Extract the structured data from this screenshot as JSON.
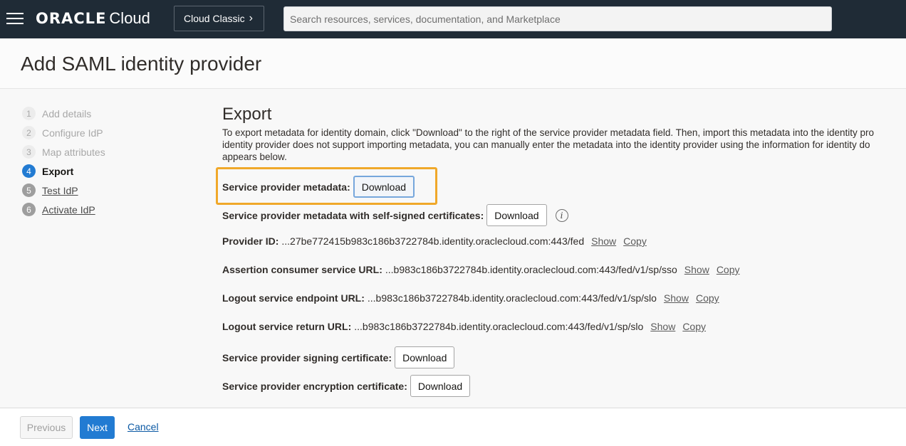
{
  "header": {
    "brand": "ORACLE",
    "product": "Cloud",
    "classic_button": "Cloud Classic",
    "search_placeholder": "Search resources, services, documentation, and Marketplace"
  },
  "page": {
    "title": "Add SAML identity provider"
  },
  "steps": [
    {
      "num": "1",
      "label": "Add details",
      "state": "done"
    },
    {
      "num": "2",
      "label": "Configure IdP",
      "state": "done"
    },
    {
      "num": "3",
      "label": "Map attributes",
      "state": "done"
    },
    {
      "num": "4",
      "label": "Export",
      "state": "active"
    },
    {
      "num": "5",
      "label": "Test IdP",
      "state": "link"
    },
    {
      "num": "6",
      "label": "Activate IdP",
      "state": "link"
    }
  ],
  "export": {
    "title": "Export",
    "description_lines": [
      "To export metadata for identity domain, click \"Download\" to the right of the service provider metadata field. Then, import this metadata into the identity pro",
      "identity provider does not support importing metadata, you can manually enter the metadata into the identity provider using the information for identity do",
      "appears below."
    ],
    "sp_metadata_label": "Service provider metadata:",
    "sp_metadata_self_signed_label": "Service provider metadata with self-signed certificates:",
    "download_label": "Download",
    "info_icon": "i",
    "provider_id": {
      "label": "Provider ID:",
      "value": "...27be772415b983c186b3722784b.identity.oraclecloud.com:443/fed"
    },
    "acs_url": {
      "label": "Assertion consumer service URL:",
      "value": "...b983c186b3722784b.identity.oraclecloud.com:443/fed/v1/sp/sso"
    },
    "logout_endpoint": {
      "label": "Logout service endpoint URL:",
      "value": "...b983c186b3722784b.identity.oraclecloud.com:443/fed/v1/sp/slo"
    },
    "logout_return": {
      "label": "Logout service return URL:",
      "value": "...b983c186b3722784b.identity.oraclecloud.com:443/fed/v1/sp/slo"
    },
    "show_label": "Show",
    "copy_label": "Copy",
    "signing_cert_label": "Service provider signing certificate:",
    "encryption_cert_label": "Service provider encryption certificate:"
  },
  "footer": {
    "previous_label": "Previous",
    "next_label": "Next",
    "cancel_label": "Cancel"
  },
  "colors": {
    "topbar": "#1f2b36",
    "accent": "#227bd2",
    "highlight": "#f0a82a"
  }
}
